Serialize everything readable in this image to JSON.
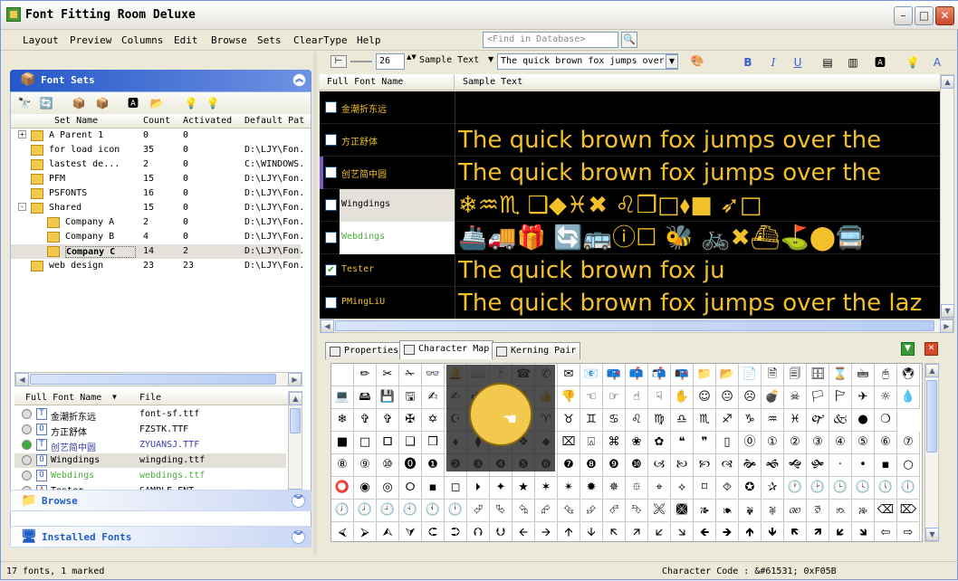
{
  "window": {
    "title": "Font Fitting Room Deluxe"
  },
  "menu": [
    "Layout",
    "Preview",
    "Columns",
    "Edit",
    "Browse",
    "Sets",
    "ClearType",
    "Help"
  ],
  "find": {
    "placeholder": "<Find in Database>"
  },
  "font_sets": {
    "title": "Font Sets",
    "columns": [
      "Set Name",
      "Count",
      "Activated",
      "Default Pat"
    ],
    "rows": [
      {
        "name": "A Parent 1",
        "count": "0",
        "activated": "0",
        "path": "",
        "indent": 0,
        "expander": "+"
      },
      {
        "name": "for load icon",
        "count": "35",
        "activated": "0",
        "path": "D:\\LJY\\Fon.",
        "indent": 0,
        "expander": ""
      },
      {
        "name": "lastest de...",
        "count": "2",
        "activated": "0",
        "path": "C:\\WINDOWS.",
        "indent": 0,
        "expander": ""
      },
      {
        "name": "PFM",
        "count": "15",
        "activated": "0",
        "path": "D:\\LJY\\Fon.",
        "indent": 0,
        "expander": ""
      },
      {
        "name": "PSFONTS",
        "count": "16",
        "activated": "0",
        "path": "D:\\LJY\\Fon.",
        "indent": 0,
        "expander": ""
      },
      {
        "name": "Shared",
        "count": "15",
        "activated": "0",
        "path": "D:\\LJY\\Fon.",
        "indent": 0,
        "expander": "-"
      },
      {
        "name": "Company A",
        "count": "2",
        "activated": "0",
        "path": "D:\\LJY\\Fon.",
        "indent": 1,
        "expander": ""
      },
      {
        "name": "Company B",
        "count": "4",
        "activated": "0",
        "path": "D:\\LJY\\Fon.",
        "indent": 1,
        "expander": ""
      },
      {
        "name": "Company C",
        "count": "14",
        "activated": "2",
        "path": "D:\\LJY\\Fon.",
        "indent": 1,
        "expander": "",
        "selected": true
      },
      {
        "name": "web design",
        "count": "23",
        "activated": "23",
        "path": "D:\\LJY\\Fon.",
        "indent": 0,
        "expander": ""
      }
    ]
  },
  "font_list": {
    "columns": [
      "Full Font Name",
      "File"
    ],
    "rows": [
      {
        "name": "金潮折东远",
        "file": "font-sf.ttf",
        "type": "T",
        "color": "#000000"
      },
      {
        "name": "方正舒体",
        "file": "FZSTK.TTF",
        "type": "O",
        "color": "#000000"
      },
      {
        "name": "创艺简中圆",
        "file": "ZYUANSJ.TTF",
        "type": "T",
        "color": "#3a3aa8"
      },
      {
        "name": "Wingdings",
        "file": "wingding.ttf",
        "type": "O",
        "color": "#000000"
      },
      {
        "name": "Webdings",
        "file": "webdings.ttf",
        "type": "O",
        "color": "#4cae3c"
      },
      {
        "name": "Tester",
        "file": "SAMPLE.FNT",
        "type": "A",
        "color": "#000000"
      }
    ]
  },
  "browse": {
    "title": "Browse"
  },
  "installed": {
    "title": "Installed Fonts"
  },
  "toolbar": {
    "size": "26",
    "mode": "Sample Text",
    "sample": "The quick brown fox jumps over"
  },
  "preview": {
    "columns": [
      "Full Font Name",
      "Sample Text"
    ],
    "rows": [
      {
        "name": "金潮折东远",
        "sample": "",
        "checked": false,
        "style": "normal"
      },
      {
        "name": "方正舒体",
        "sample": "The quick brown fox jumps over the",
        "checked": false,
        "style": "normal"
      },
      {
        "name": "创艺简中圆",
        "sample": "The quick brown fox jumps over the",
        "checked": false,
        "style": "bold",
        "mark": "#7a58c8"
      },
      {
        "name": "Wingdings",
        "sample": "❄♒♏ ❑◆♓✖ ♌❒□⬧■ ➶□",
        "checked": false,
        "style": "symbol",
        "selected": true
      },
      {
        "name": "Webdings",
        "sample": "🚢🚚🎁 🔄🚌ⓘ☐ 🐝 🚲✖⛴⛳⬤🚍",
        "checked": false,
        "style": "symbol",
        "light": true
      },
      {
        "name": "Tester",
        "sample": "The quick brown fox ju",
        "checked": true,
        "style": "mono"
      },
      {
        "name": "PMingLiU",
        "sample": "The quick brown fox jumps over the laz",
        "checked": false,
        "style": "serif"
      }
    ]
  },
  "tabs": [
    "Properties",
    "Character Map",
    "Kerning Pair"
  ],
  "charmap": {
    "rows": [
      [
        "",
        "✏",
        "✂",
        "✁",
        "👓",
        "🔔",
        "📖",
        "🕯",
        "☎",
        "✆",
        "✉",
        "📧",
        "📪",
        "📫",
        "📬",
        "📭",
        "📁",
        "📂",
        "📄",
        "🗎",
        "🗐",
        "🗄",
        "⌛",
        "🖮",
        "🖰",
        "🖲"
      ],
      [
        "💻",
        "🖴",
        "💾",
        "🖫",
        "✍",
        "✍",
        "🖎",
        "✌",
        "👌",
        "👍",
        "👎",
        "☜",
        "☞",
        "☝",
        "☟",
        "✋",
        "☺",
        "😐",
        "☹",
        "💣",
        "☠",
        "🏳",
        "🏱",
        "✈",
        "☼",
        "💧"
      ],
      [
        "❄",
        "✞",
        "✞",
        "✠",
        "✡",
        "☪",
        "☯",
        "ॐ",
        "☸",
        "♈",
        "♉",
        "♊",
        "♋",
        "♌",
        "♍",
        "♎",
        "♏",
        "♐",
        "♑",
        "♒",
        "♓",
        "🙰",
        "🙵",
        "●",
        "❍"
      ],
      [
        "■",
        "□",
        "🞐",
        "❑",
        "❒",
        "⬧",
        "⧫",
        "◆",
        "❖",
        "⬥",
        "⌧",
        "⍓",
        "⌘",
        "❀",
        "✿",
        "❝",
        "❞",
        "▯",
        "⓪",
        "①",
        "②",
        "③",
        "④",
        "⑤",
        "⑥",
        "⑦"
      ],
      [
        "⑧",
        "⑨",
        "⑩",
        "⓿",
        "❶",
        "❷",
        "❸",
        "❹",
        "❺",
        "❻",
        "❼",
        "❽",
        "❾",
        "❿",
        "🙢",
        "🙠",
        "🙡",
        "🙣",
        "🙞",
        "🙜",
        "🙝",
        "🙟",
        "·",
        "•",
        "▪",
        "○"
      ],
      [
        "⭕",
        "◉",
        "◎",
        "🞆",
        "▪",
        "◻",
        "🞂",
        "✦",
        "★",
        "✶",
        "✴",
        "✹",
        "✵",
        "⯐",
        "⌖",
        "⟡",
        "⌑",
        "⯑",
        "✪",
        "✰",
        "🕐",
        "🕑",
        "🕒",
        "🕓",
        "🕔",
        "🕕"
      ],
      [
        "🕖",
        "🕗",
        "🕘",
        "🕙",
        "🕚",
        "🕛",
        "⮰",
        "⮱",
        "⮲",
        "⮳",
        "⮴",
        "⮵",
        "⮶",
        "⮷",
        "🙪",
        "🙫",
        "🙕",
        "🙔",
        "🙗",
        "🙖",
        "🙐",
        "🙑",
        "🙒",
        "🙓",
        "⌫",
        "⌦"
      ],
      [
        "⮘",
        "⮚",
        "⮙",
        "⮛",
        "⮈",
        "⮊",
        "⮉",
        "⮋",
        "🡨",
        "🡪",
        "🡩",
        "🡫",
        "🡬",
        "🡭",
        "🡯",
        "🡮",
        "🡸",
        "🡺",
        "🡹",
        "🡻",
        "🡼",
        "🡽",
        "🡿",
        "🡾",
        "⇦",
        "⇨"
      ]
    ]
  },
  "status": {
    "left": "17 fonts, 1 marked",
    "right": "Character Code : &#61531; 0xF05B"
  },
  "colors": {
    "accent": "#2457c8",
    "sample_text": "#f2c02a",
    "preview_bg": "#000000"
  }
}
